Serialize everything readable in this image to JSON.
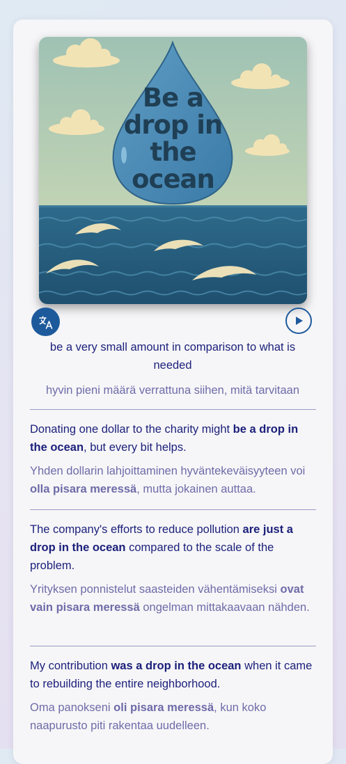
{
  "idiom": {
    "image_text": "Be a drop in the ocean",
    "definition": "be a very small amount in comparison to what is needed",
    "definition_translation": "hyvin pieni määrä verrattuna siihen, mitä tarvitaan"
  },
  "controls": {
    "translate_icon": "translate-icon",
    "play_icon": "play-icon"
  },
  "examples": [
    {
      "en_before": "Donating one dollar to the charity might ",
      "en_bold": "be a drop in the ocean",
      "en_after": ", but every bit helps.",
      "fi_before": "Yhden dollarin lahjoittaminen hyväntekeväisyyteen voi ",
      "fi_bold": "olla pisara meressä",
      "fi_after": ", mutta jokainen auttaa."
    },
    {
      "en_before": "The company's efforts to reduce pollution ",
      "en_bold": "are just a drop in the ocean",
      "en_after": " compared to the scale of the problem.",
      "fi_before": "Yrityksen ponnistelut saasteiden vähentämiseksi ",
      "fi_bold": "ovat vain pisara meressä",
      "fi_after": " ongelman mittakaavaan nähden."
    },
    {
      "en_before": "My contribution ",
      "en_bold": "was a drop in the ocean",
      "en_after": " when it came to rebuilding the entire neighborhood.",
      "fi_before": "Oma panokseni ",
      "fi_bold": "oli pisara meressä",
      "fi_after": ", kun koko naapurusto piti rakentaa uudelleen."
    }
  ],
  "colors": {
    "accent": "#1d5a9c",
    "text_primary": "#1b1f7a",
    "text_secondary": "#6e6ba8"
  }
}
